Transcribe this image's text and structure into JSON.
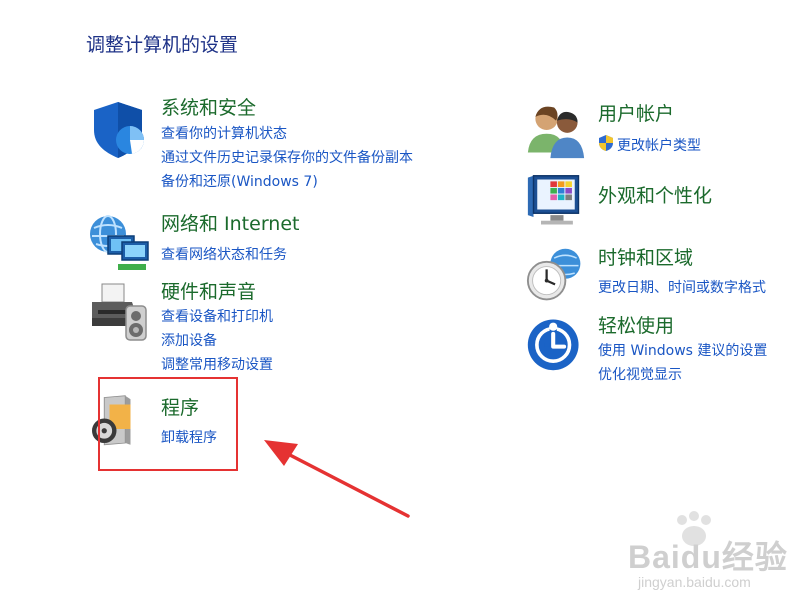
{
  "heading": "调整计算机的设置",
  "left_categories": [
    {
      "icon": "shield-icon",
      "title": "系统和安全",
      "links": [
        "查看你的计算机状态",
        "通过文件历史记录保存你的文件备份副本",
        "备份和还原(Windows 7)"
      ]
    },
    {
      "icon": "network-icon",
      "title": "网络和 Internet",
      "links": [
        "查看网络状态和任务"
      ]
    },
    {
      "icon": "printer-icon",
      "title": "硬件和声音",
      "links": [
        "查看设备和打印机",
        "添加设备",
        "调整常用移动设置"
      ]
    },
    {
      "icon": "programs-icon",
      "title": "程序",
      "links": [
        "卸载程序"
      ]
    }
  ],
  "right_categories": [
    {
      "icon": "users-icon",
      "title": "用户帐户",
      "links": [
        "更改帐户类型"
      ]
    },
    {
      "icon": "display-icon",
      "title": "外观和个性化",
      "links": []
    },
    {
      "icon": "clock-globe-icon",
      "title": "时钟和区域",
      "links": [
        "更改日期、时间或数字格式"
      ]
    },
    {
      "icon": "ease-of-access-icon",
      "title": "轻松使用",
      "links": [
        "使用 Windows 建议的设置",
        "优化视觉显示"
      ]
    }
  ],
  "watermark": {
    "brand": "Baidu经验",
    "url": "jingyan.baidu.com"
  },
  "colors": {
    "heading": "#1e3287",
    "category_title": "#1b6a2c",
    "link": "#1a56c4",
    "annotation": "#e53232"
  }
}
